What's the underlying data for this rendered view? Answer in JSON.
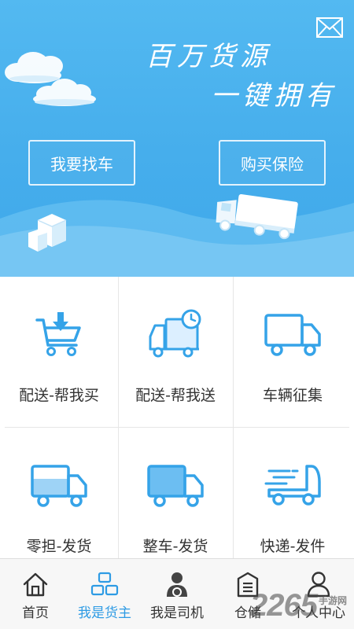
{
  "banner": {
    "slogan_line1": "百万货源",
    "slogan_line2": "一键拥有",
    "find_truck_label": "我要找车",
    "buy_insurance_label": "购买保险",
    "mail_icon": "mail-icon"
  },
  "services": [
    {
      "label": "配送-帮我买",
      "icon": "cart-download-icon"
    },
    {
      "label": "配送-帮我送",
      "icon": "truck-clock-icon"
    },
    {
      "label": "车辆征集",
      "icon": "truck-icon"
    },
    {
      "label": "零担-发货",
      "icon": "partial-load-truck-icon"
    },
    {
      "label": "整车-发货",
      "icon": "full-load-truck-icon"
    },
    {
      "label": "快递-发件",
      "icon": "express-truck-icon"
    }
  ],
  "tabs": [
    {
      "label": "首页",
      "icon": "home-icon",
      "active": false
    },
    {
      "label": "我是货主",
      "icon": "cargo-owner-icon",
      "active": true
    },
    {
      "label": "我是司机",
      "icon": "driver-icon",
      "active": false
    },
    {
      "label": "仓储",
      "icon": "warehouse-icon",
      "active": false
    },
    {
      "label": "个人中心",
      "icon": "user-icon",
      "active": false
    }
  ],
  "watermark": {
    "number": "2265",
    "text": "手游网"
  },
  "colors": {
    "banner": "#46aeec",
    "accent": "#2e9be4",
    "icon_blue": "#35a3e8"
  }
}
